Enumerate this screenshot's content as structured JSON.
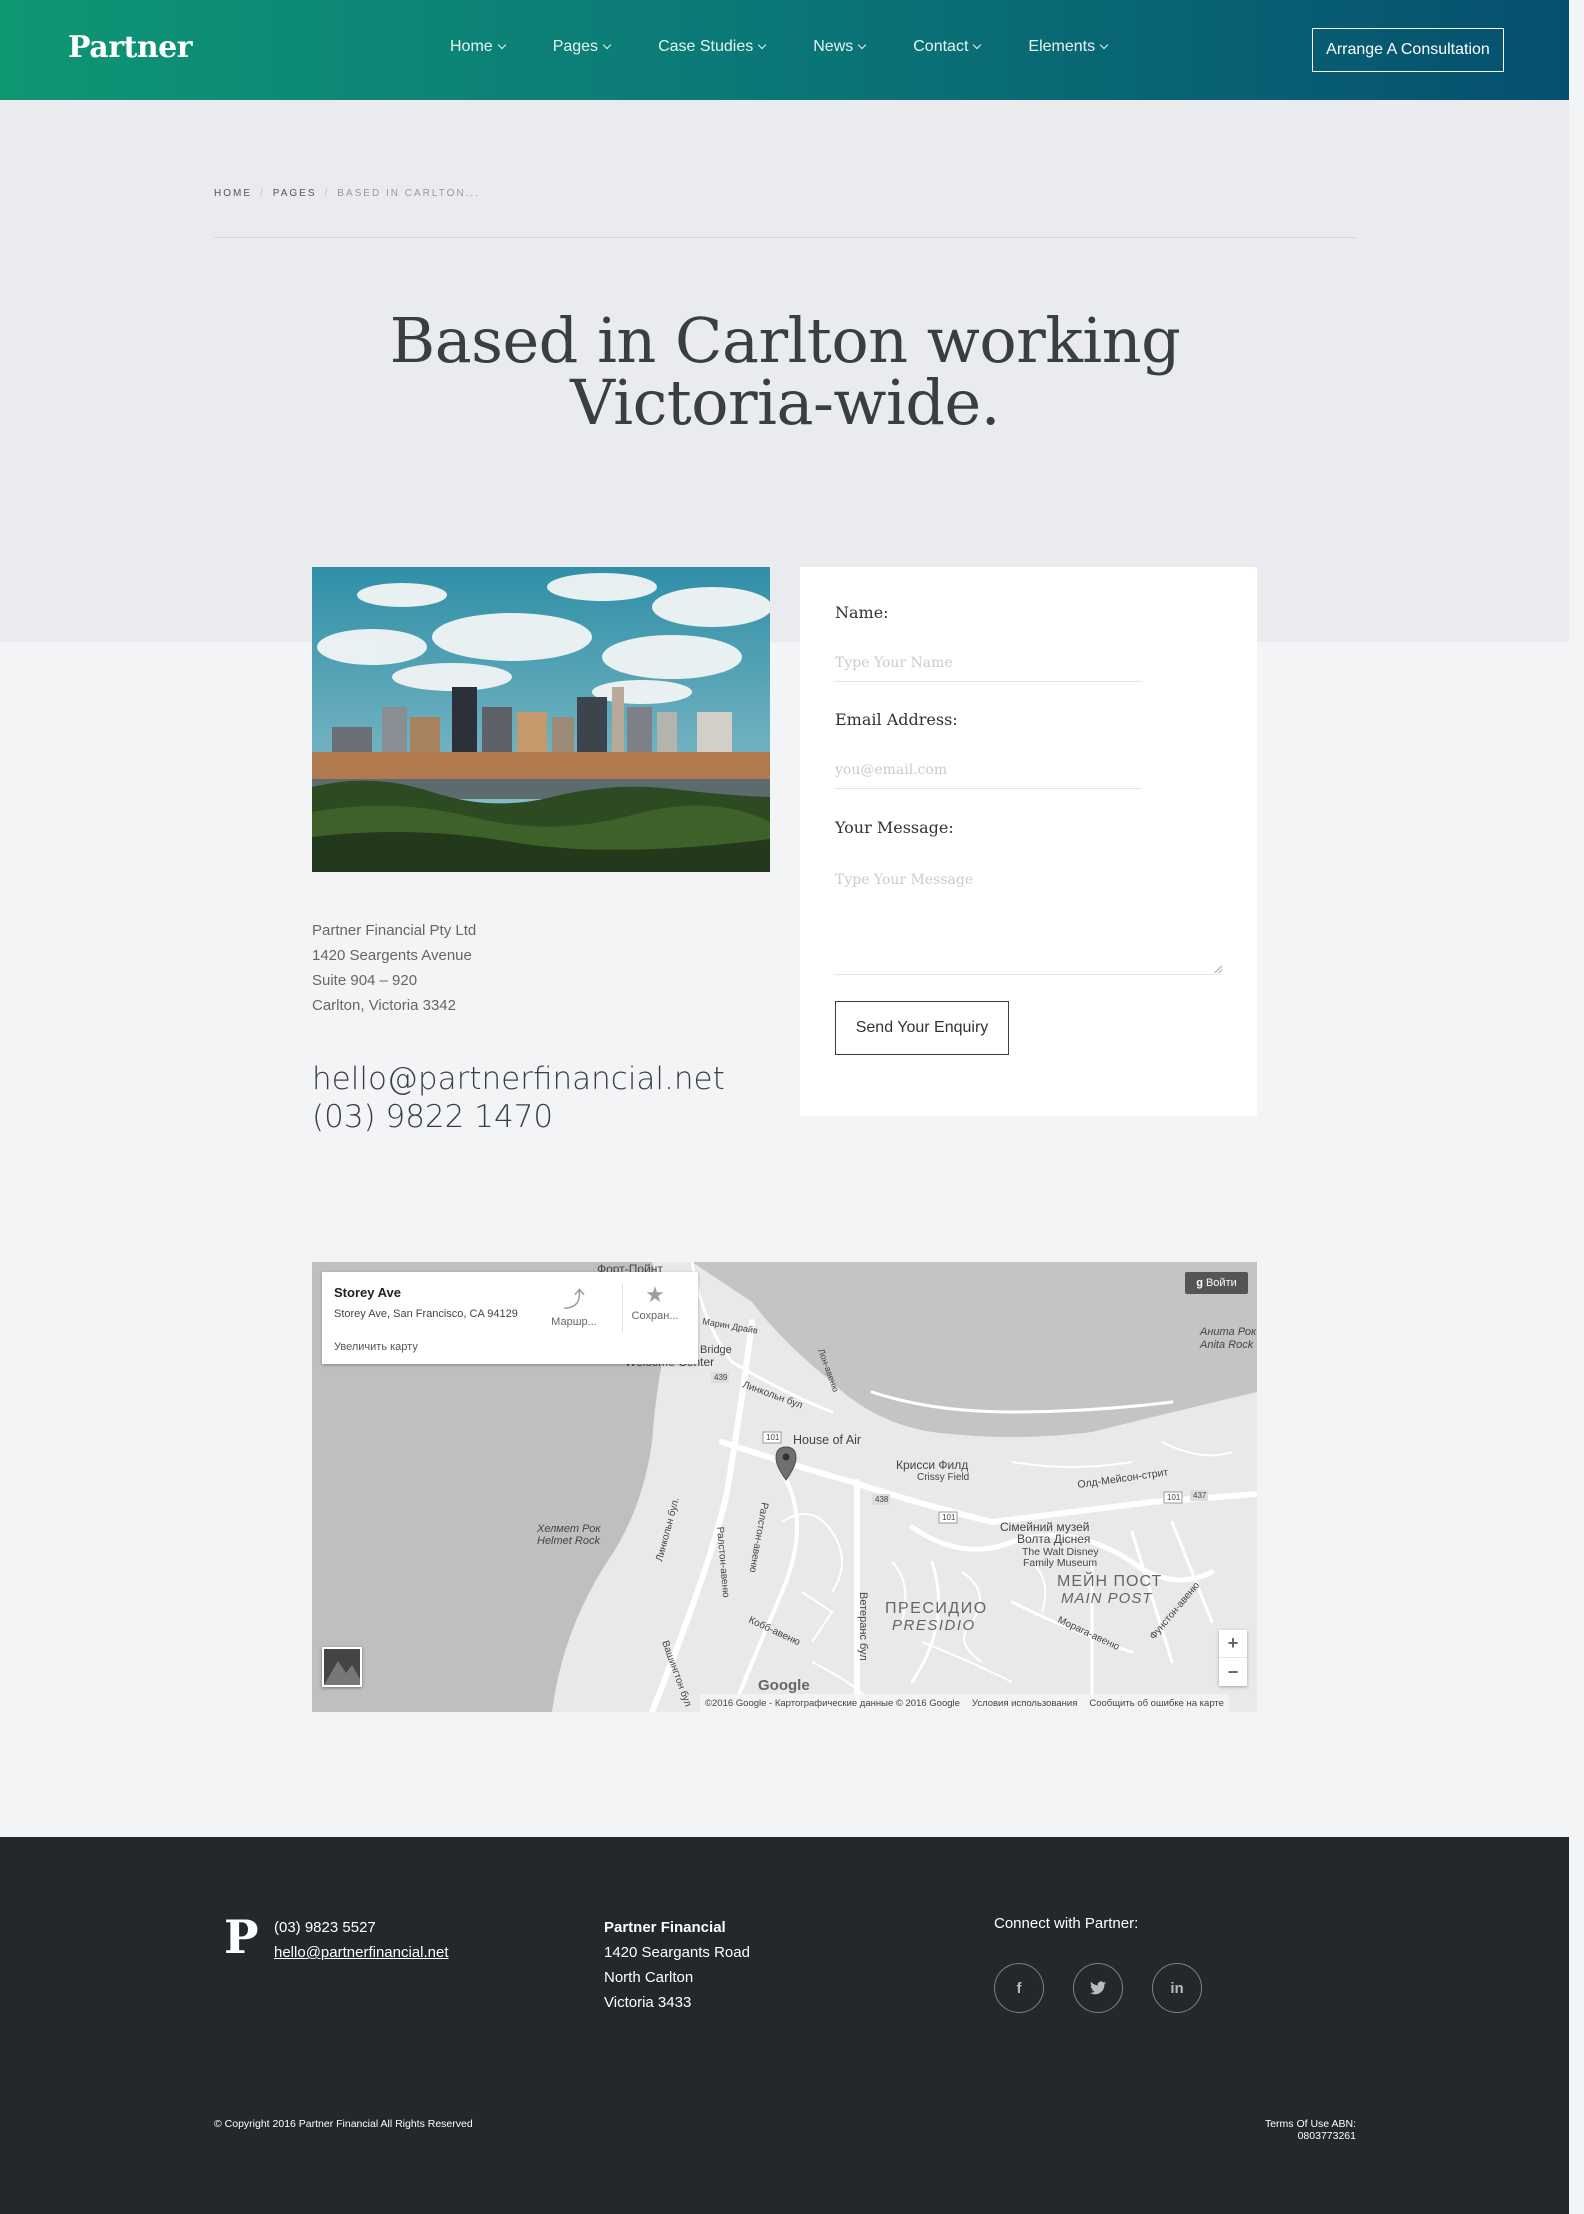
{
  "header": {
    "logo": "Partner",
    "nav": [
      {
        "label": "Home"
      },
      {
        "label": "Pages"
      },
      {
        "label": "Case Studies"
      },
      {
        "label": "News"
      },
      {
        "label": "Contact"
      },
      {
        "label": "Elements"
      }
    ],
    "cta_label": "Arrange A Consultation",
    "gradient": [
      "#0f9673",
      "#06506f"
    ]
  },
  "breadcrumb": {
    "items": [
      "HOME",
      "PAGES"
    ],
    "current": "BASED IN CARLTON..."
  },
  "hero": {
    "title": "Based in Carlton working Victoria-wide."
  },
  "address": {
    "lines": [
      "Partner Financial Pty Ltd",
      "1420 Seargents Avenue",
      "Suite 904 – 920",
      "Carlton, Victoria 3342"
    ]
  },
  "contact": {
    "email": "hello@partnerfinancial.net",
    "phone": "(03) 9822 1470"
  },
  "form": {
    "name_label": "Name:",
    "name_placeholder": "Type Your Name",
    "email_label": "Email Address:",
    "email_placeholder": "you@email.com",
    "message_label": "Your Message:",
    "message_placeholder": "Type Your Message",
    "submit_label": "Send Your Enquiry"
  },
  "map": {
    "card_title": "Storey Ave",
    "card_address": "Storey Ave, San Francisco, CA 94129",
    "card_link": "Увеличить карту",
    "action_route": "Маршр...",
    "action_save": "Сохран...",
    "login_label": "Войти",
    "zoom_in": "+",
    "zoom_out": "−",
    "brand": "Google",
    "attribution": "©2016 Google - Картографические данные © 2016 Google",
    "terms": "Условия использования",
    "report": "Сообщить об ошибке на карте",
    "labels": {
      "fort_point": "Форт-Пойнт",
      "marin": "Марин Драйв",
      "bridge": "Bridge",
      "welcome": "Welcome Center",
      "anita_ru": "Анита Рок",
      "anita_en": "Anita Rock",
      "house_of_air": "House of Air",
      "crissy_ru": "Крисси Филд",
      "crissy_en": "Crissy Field",
      "old_mason": "Олд-Мейсон-стрит",
      "helmet_ru": "Хелмет Рок",
      "helmet_en": "Helmet Rock",
      "museum_ru": "Сімейний музей",
      "museum_ru2": "Волта Діснея",
      "museum_en": "The Walt Disney",
      "museum_en2": "Family Museum",
      "main_post_ru": "МЕЙН ПОСТ",
      "main_post_en": "MAIN POST",
      "presidio_ru": "ПРЕСИДИО",
      "presidio_en": "PRESIDIO",
      "lincoln": "Линкольн бул",
      "lincoln2": "Линкольн бул.",
      "ralston": "Ралстон-авеню",
      "veterans": "Ветеранс бул",
      "kobb": "Кобб-авеню",
      "washington": "Вашингтон бул",
      "moraga": "Морага-авеню",
      "funston": "Фунстон-авеню",
      "lone": "Лон-авеню",
      "r101a": "101",
      "r101b": "101",
      "r101c": "101",
      "r439": "439",
      "r438": "438",
      "r437": "437"
    }
  },
  "footer": {
    "logo_letter": "P",
    "phone": "(03) 9823 5527",
    "email": "hello@partnerfinancial.net",
    "company": "Partner Financial",
    "address_lines": [
      "1420 Seargants Road",
      "North Carlton",
      "Victoria 3433"
    ],
    "connect_label": "Connect with Partner:",
    "social": [
      "f",
      "twitter",
      "in"
    ],
    "copyright": "© Copyright 2016 Partner Financial All Rights Reserved",
    "terms": "Terms Of Use ABN: 0803773261"
  }
}
